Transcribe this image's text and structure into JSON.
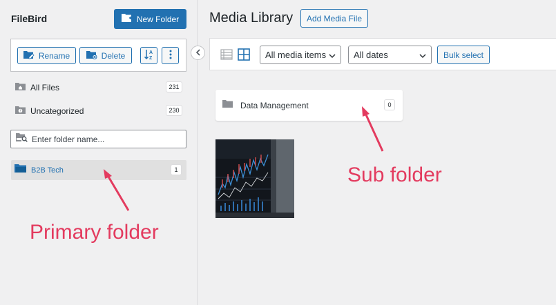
{
  "sidebar": {
    "app_title": "FileBird",
    "new_folder_label": "New Folder",
    "rename_label": "Rename",
    "delete_label": "Delete",
    "all_files": {
      "label": "All Files",
      "count": "231"
    },
    "uncategorized": {
      "label": "Uncategorized",
      "count": "230"
    },
    "search_placeholder": "Enter folder name...",
    "folders": [
      {
        "label": "B2B Tech",
        "count": "1"
      }
    ]
  },
  "main": {
    "title": "Media Library",
    "add_media_label": "Add Media File",
    "filter_media_value": "All media items",
    "filter_dates_value": "All dates",
    "bulk_select_label": "Bulk select",
    "subfolders": [
      {
        "label": "Data Management",
        "count": "0"
      }
    ]
  },
  "annotations": {
    "primary": "Primary folder",
    "sub": "Sub folder"
  },
  "colors": {
    "accent": "#2271b1",
    "annotation": "#e33b5f",
    "background": "#f0f0f1"
  }
}
